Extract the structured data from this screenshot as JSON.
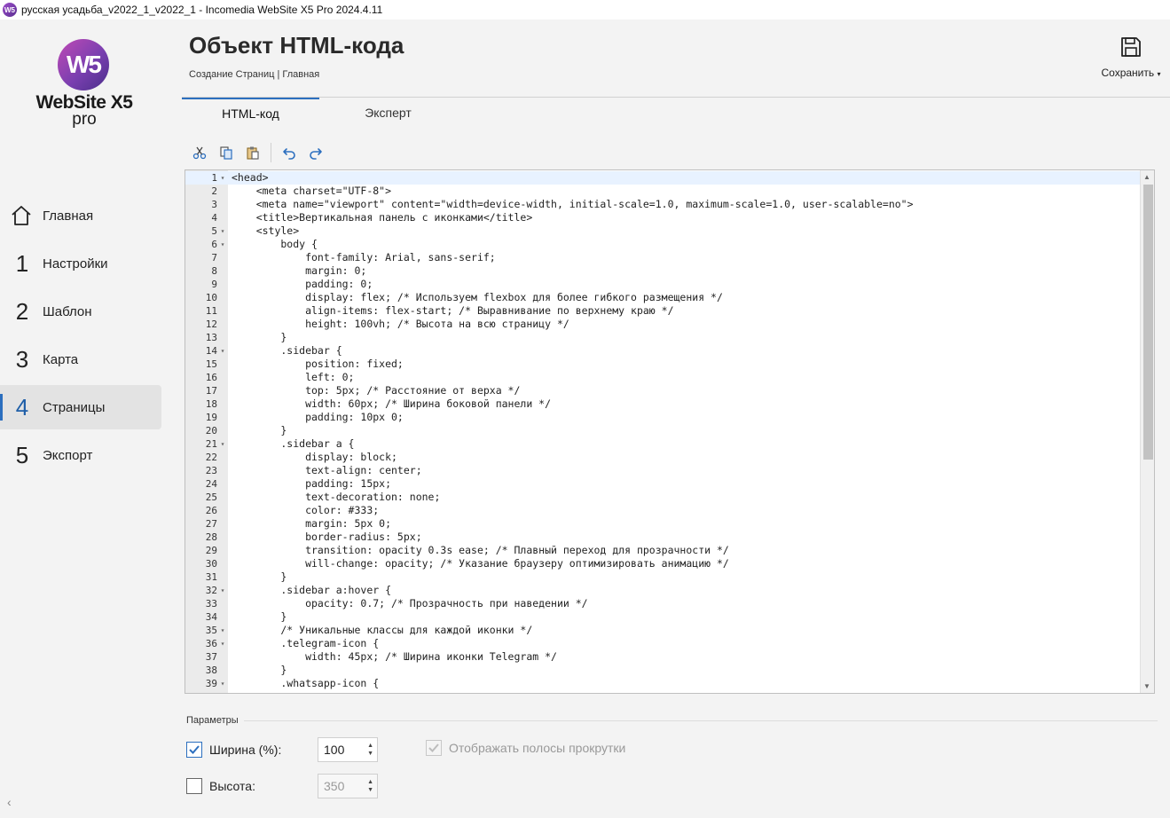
{
  "window": {
    "title": "русская усадьба_v2022_1_v2022_1 - Incomedia WebSite X5 Pro 2024.4.11"
  },
  "logo": {
    "mark": "W5",
    "name": "WebSite X5",
    "edition": "pro"
  },
  "nav": {
    "items": [
      {
        "num": "",
        "label": "Главная"
      },
      {
        "num": "1",
        "label": "Настройки"
      },
      {
        "num": "2",
        "label": "Шаблон"
      },
      {
        "num": "3",
        "label": "Карта"
      },
      {
        "num": "4",
        "label": "Страницы"
      },
      {
        "num": "5",
        "label": "Экспорт"
      }
    ],
    "active_index": 4
  },
  "header": {
    "title": "Объект HTML-кода",
    "breadcrumb": "Создание Страниц | Главная",
    "save_label": "Сохранить"
  },
  "tabs": [
    {
      "label": "HTML-код",
      "active": true
    },
    {
      "label": "Эксперт",
      "active": false
    }
  ],
  "toolbar": [
    "cut-icon",
    "copy-icon",
    "paste-icon",
    "undo-icon",
    "redo-icon"
  ],
  "editor": {
    "lines": [
      "<head>",
      "    <meta charset=\"UTF-8\">",
      "    <meta name=\"viewport\" content=\"width=device-width, initial-scale=1.0, maximum-scale=1.0, user-scalable=no\">",
      "    <title>Вертикальная панель с иконками</title>",
      "    <style>",
      "        body {",
      "            font-family: Arial, sans-serif;",
      "            margin: 0;",
      "            padding: 0;",
      "            display: flex; /* Используем flexbox для более гибкого размещения */",
      "            align-items: flex-start; /* Выравнивание по верхнему краю */",
      "            height: 100vh; /* Высота на всю страницу */",
      "        }",
      "        .sidebar {",
      "            position: fixed;",
      "            left: 0;",
      "            top: 5px; /* Расстояние от верха */",
      "            width: 60px; /* Ширина боковой панели */",
      "            padding: 10px 0;",
      "        }",
      "        .sidebar a {",
      "            display: block;",
      "            text-align: center;",
      "            padding: 15px;",
      "            text-decoration: none;",
      "            color: #333;",
      "            margin: 5px 0;",
      "            border-radius: 5px;",
      "            transition: opacity 0.3s ease; /* Плавный переход для прозрачности */",
      "            will-change: opacity; /* Указание браузеру оптимизировать анимацию */",
      "        }",
      "        .sidebar a:hover {",
      "            opacity: 0.7; /* Прозрачность при наведении */",
      "        }",
      "        /* Уникальные классы для каждой иконки */",
      "        .telegram-icon {",
      "            width: 45px; /* Ширина иконки Telegram */",
      "        }",
      "        .whatsapp-icon {"
    ],
    "fold_lines": [
      1,
      5,
      6,
      14,
      21,
      32,
      35,
      36,
      39
    ]
  },
  "params": {
    "title": "Параметры",
    "width": {
      "label": "Ширина (%):",
      "checked": true,
      "value": "100"
    },
    "height": {
      "label": "Высота:",
      "checked": false,
      "value": "350"
    },
    "scrollbars": {
      "label": "Отображать полосы прокрутки",
      "checked": true,
      "disabled": true
    }
  },
  "colors": {
    "accent": "#2c6fbf",
    "brand_purple": "#7a3fb0"
  }
}
